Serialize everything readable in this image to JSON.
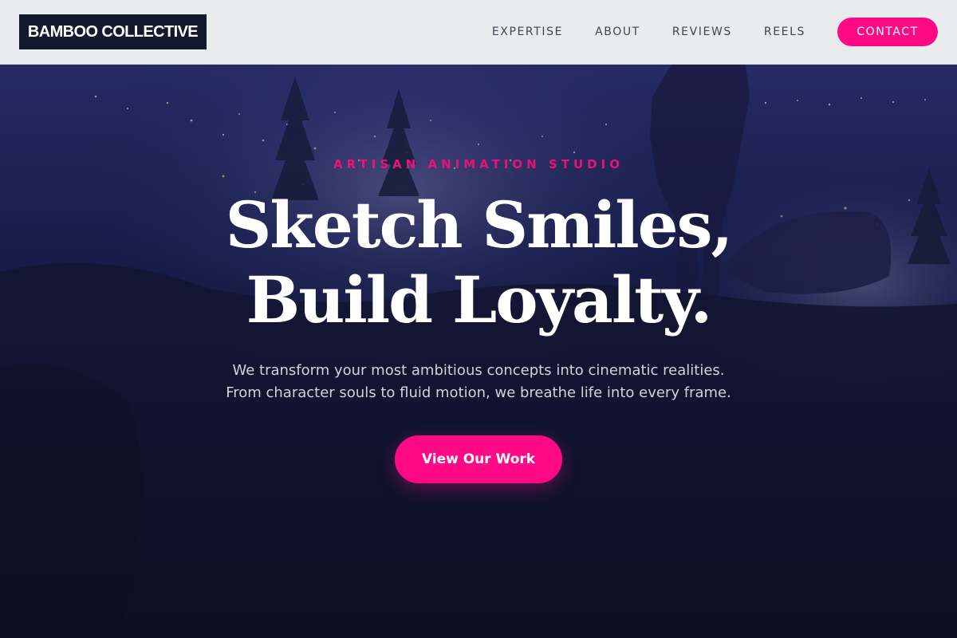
{
  "brand": {
    "logo_text": "BAMBOO COLLECTIVE"
  },
  "nav": {
    "links": [
      "EXPERTISE",
      "ABOUT",
      "REVIEWS",
      "REELS"
    ],
    "contact_label": "CONTACT"
  },
  "hero": {
    "eyebrow": "ARTISAN ANIMATION STUDIO",
    "headline_line1": "Sketch Smiles,",
    "headline_line2": "Build Loyalty.",
    "subtext_line1": "We transform your most ambitious concepts into cinematic realities.",
    "subtext_line2": "From character souls to fluid motion, we breathe life into every frame.",
    "cta_label": "View Our Work"
  },
  "colors": {
    "accent": "#ff0a84",
    "logo_bg": "#131a2e",
    "header_bg": "#e9ebef",
    "hero_overlay": "#0e1230"
  }
}
